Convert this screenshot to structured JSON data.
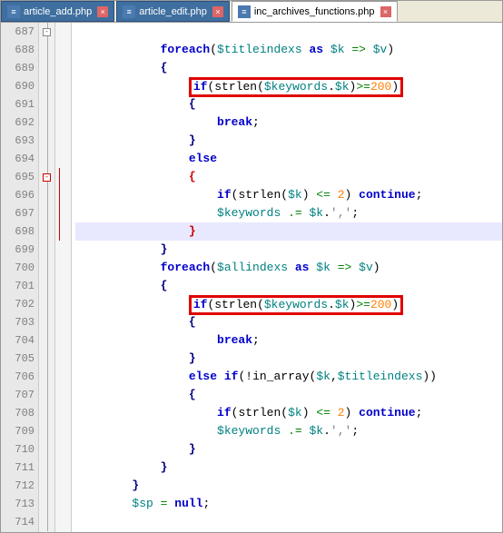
{
  "tabs": [
    {
      "label": "article_add.php",
      "active": false
    },
    {
      "label": "article_edit.php",
      "active": false
    },
    {
      "label": "inc_archives_functions.php",
      "active": true
    }
  ],
  "lines": {
    "start": 687,
    "end": 714
  },
  "code": {
    "l688_foreach": "foreach",
    "l688_var1": "$titleindexs",
    "l688_as": "as",
    "l688_k": "$k",
    "l688_arrow": "=>",
    "l688_v": "$v",
    "l689_brace": "{",
    "l690_if": "if",
    "l690_strlen": "strlen",
    "l690_kw": "$keywords",
    "l690_dot": ".",
    "l690_k": "$k",
    "l690_cmp": ">=",
    "l690_n": "200",
    "l691_brace": "{",
    "l692_break": "break",
    "l692_semi": ";",
    "l693_brace": "}",
    "l694_else": "else",
    "l695_brace": "{",
    "l696_if": "if",
    "l696_strlen": "strlen",
    "l696_k": "$k",
    "l696_cmp": "<=",
    "l696_n": "2",
    "l696_cont": "continue",
    "l696_semi": ";",
    "l697_kw": "$keywords",
    "l697_opeq": ".=",
    "l697_k": "$k",
    "l697_dot": ".",
    "l697_str": "','",
    "l697_semi": ";",
    "l698_brace": "}",
    "l699_brace": "}",
    "l700_foreach": "foreach",
    "l700_var1": "$allindexs",
    "l700_as": "as",
    "l700_k": "$k",
    "l700_arrow": "=>",
    "l700_v": "$v",
    "l701_brace": "{",
    "l702_if": "if",
    "l702_strlen": "strlen",
    "l702_kw": "$keywords",
    "l702_dot": ".",
    "l702_k": "$k",
    "l702_cmp": ">=",
    "l702_n": "200",
    "l703_brace": "{",
    "l704_break": "break",
    "l704_semi": ";",
    "l705_brace": "}",
    "l706_else": "else",
    "l706_if": "if",
    "l706_not": "!",
    "l706_inarr": "in_array",
    "l706_k": "$k",
    "l706_comma": ",",
    "l706_ti": "$titleindexs",
    "l707_brace": "{",
    "l708_if": "if",
    "l708_strlen": "strlen",
    "l708_k": "$k",
    "l708_cmp": "<=",
    "l708_n": "2",
    "l708_cont": "continue",
    "l708_semi": ";",
    "l709_kw": "$keywords",
    "l709_opeq": ".=",
    "l709_k": "$k",
    "l709_dot": ".",
    "l709_str": "','",
    "l709_semi": ";",
    "l710_brace": "}",
    "l711_brace": "}",
    "l712_brace": "}",
    "l713_sp": "$sp",
    "l713_eq": "=",
    "l713_null": "null",
    "l713_semi": ";"
  }
}
